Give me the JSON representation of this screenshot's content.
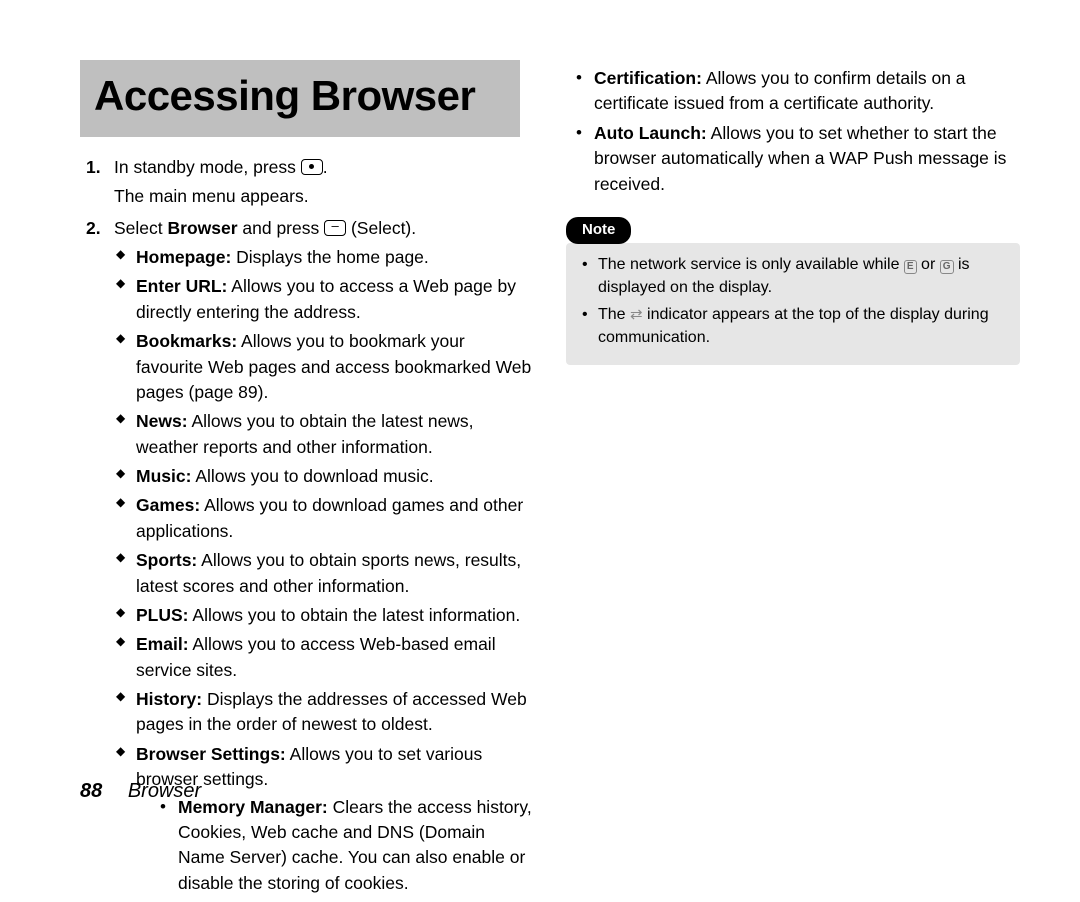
{
  "title": "Accessing Browser",
  "steps": {
    "s1_num": "1.",
    "s1_a": "In standby mode, press ",
    "s1_b": ".",
    "s1_sub": "The main menu appears.",
    "s2_num": "2.",
    "s2_a": "Select ",
    "s2_b": "Browser",
    "s2_c": " and press ",
    "s2_d": " (Select)."
  },
  "menu": {
    "homepage_b": "Homepage:",
    "homepage_t": " Displays the home page.",
    "enterurl_b": "Enter URL:",
    "enterurl_t": " Allows you to access a Web page by directly entering the address.",
    "bookmarks_b": "Bookmarks:",
    "bookmarks_t": " Allows you to bookmark your favourite Web pages and access bookmarked Web pages (page 89).",
    "news_b": "News:",
    "news_t": " Allows you to obtain the latest news, weather reports and other information.",
    "music_b": "Music:",
    "music_t": " Allows you to download music.",
    "games_b": "Games:",
    "games_t": " Allows you to download games and other applications.",
    "sports_b": "Sports:",
    "sports_t": " Allows you to obtain sports news, results, latest scores and other information.",
    "plus_b": "PLUS:",
    "plus_t": " Allows you to obtain the latest information.",
    "email_b": "Email:",
    "email_t": " Allows you to access Web-based email service sites.",
    "history_b": "History:",
    "history_t": " Displays the addresses of accessed Web pages in the order of newest to oldest.",
    "bsettings_b": "Browser Settings:",
    "bsettings_t": " Allows you to set various browser settings."
  },
  "settings_sub": {
    "mem_b": "Memory Manager:",
    "mem_t": " Clears the access history, Cookies, Web cache and DNS (Domain Name Server) cache. You can also enable or disable the storing of cookies.",
    "cert_b": "Certification:",
    "cert_t": " Allows you to confirm details on a certificate issued from a certificate authority.",
    "auto_b": "Auto Launch:",
    "auto_t": " Allows you to set whether to start the browser automatically when a WAP Push message is received."
  },
  "note": {
    "label": "Note",
    "n1_a": "The network service is only available while ",
    "n1_b": " or ",
    "n1_c": " is displayed on the display.",
    "n2_a": "The ",
    "n2_b": " indicator appears at the top of the display during communication."
  },
  "footer": {
    "page": "88",
    "section": "Browser"
  }
}
